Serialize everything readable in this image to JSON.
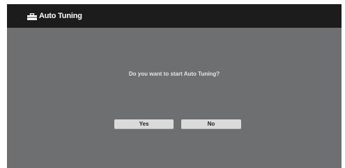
{
  "dialog": {
    "icon": "toolbox-icon",
    "title": "Auto Tuning",
    "message": "Do you want to start Auto Tuning?",
    "buttons": {
      "yes_label": "Yes",
      "no_label": "No"
    }
  },
  "colors": {
    "background": "#6e6f71",
    "title_bar": "#1c1c1c",
    "button": "#dadada"
  }
}
